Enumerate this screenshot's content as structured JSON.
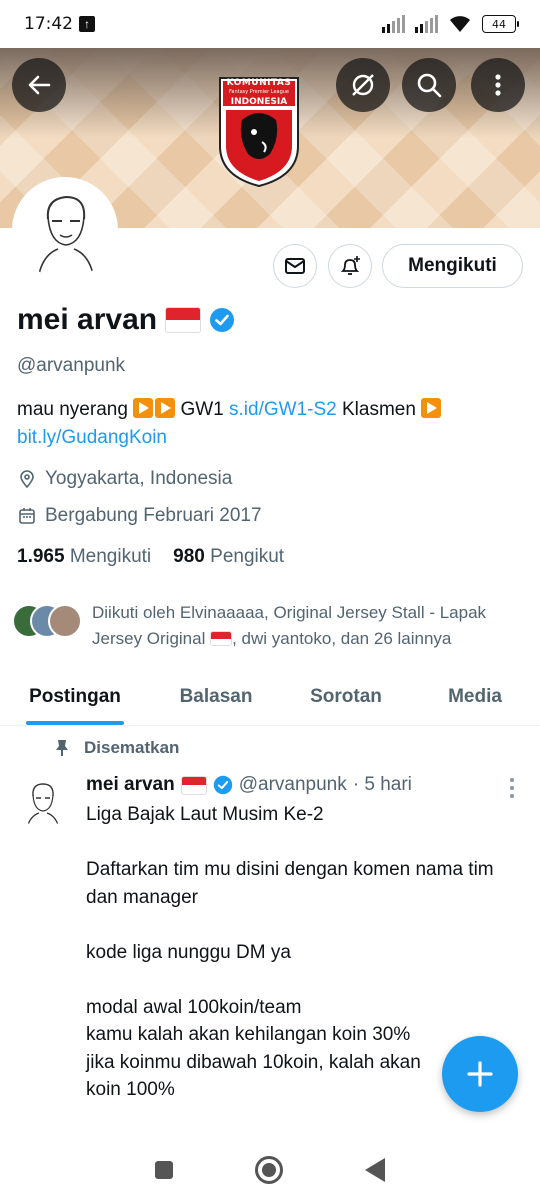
{
  "status_bar": {
    "time": "17:42",
    "battery": "44",
    "upload_icon": "upload-icon"
  },
  "banner": {
    "logo_line1": "KOMUNITAS",
    "logo_line2": "Fantasy Premier League",
    "logo_line3": "INDONESIA",
    "back_icon": "arrow-left-icon",
    "grok_icon": "grok-icon",
    "search_icon": "search-icon",
    "more_icon": "more-vertical-icon"
  },
  "profile": {
    "name": "mei arvan",
    "handle": "@arvanpunk",
    "follow_label": "Mengikuti",
    "bio_prefix": "mau nyerang",
    "bio_text1": " GW1 ",
    "bio_link1": "s.id/GW1-S2",
    "bio_text2": "  Klasmen ",
    "bio_link2": "bit.ly/GudangKoin",
    "location": "Yogyakarta, Indonesia",
    "joined": "Bergabung Februari 2017",
    "following_count": "1.965",
    "following_label": "Mengikuti",
    "followers_count": "980",
    "followers_label": "Pengikut",
    "followed_by": "Diikuti oleh Elvinaaaaa, Original Jersey Stall - Lapak Jersey Original",
    "followed_by_tail": ", dwi yantoko, dan 26 lainnya",
    "colors": {
      "accent": "#1d9bf0",
      "text": "#0f1419",
      "muted": "#536471"
    }
  },
  "tabs": [
    {
      "label": "Postingan",
      "active": true
    },
    {
      "label": "Balasan",
      "active": false
    },
    {
      "label": "Sorotan",
      "active": false
    },
    {
      "label": "Media",
      "active": false
    }
  ],
  "pinned_tweet": {
    "pinned_label": "Disematkan",
    "author_name": "mei arvan",
    "author_handle": "@arvanpunk",
    "time": "· 5 hari",
    "lines": [
      "Liga Bajak Laut Musim Ke-2",
      "",
      "Daftarkan tim mu disini dengan komen nama tim dan manager",
      "",
      "kode liga nunggu DM ya",
      "",
      "modal awal 100koin/team",
      "kamu kalah akan kehilangan koin 30%",
      "jika koinmu dibawah 10koin, kalah akan",
      "koin 100%"
    ]
  },
  "fab": {
    "icon": "plus-icon"
  }
}
